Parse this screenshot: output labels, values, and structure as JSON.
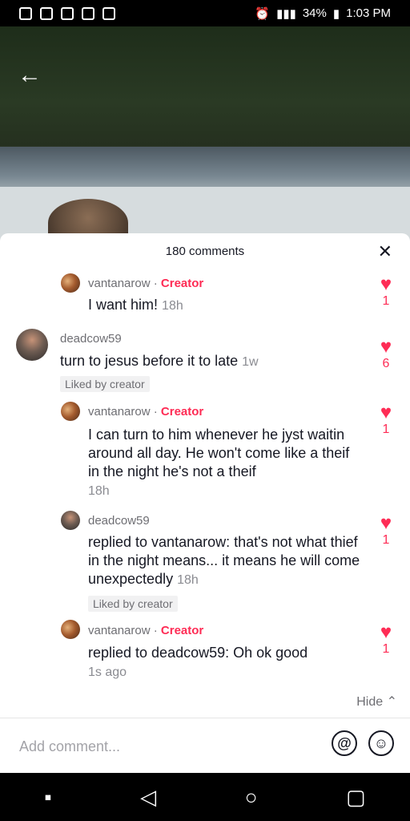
{
  "status_bar": {
    "battery": "34%",
    "time": "1:03 PM"
  },
  "sheet": {
    "title": "180 comments",
    "hide_label": "Hide",
    "add_comment_placeholder": "Add comment..."
  },
  "comments": [
    {
      "username": "vantanarow",
      "badge": "Creator",
      "separator": "·",
      "text": "I want him!",
      "time": "18h",
      "likes": "1"
    },
    {
      "username": "deadcow59",
      "text": "turn to jesus before it to late",
      "time": "1w",
      "liked_by": "Liked by creator",
      "likes": "6"
    },
    {
      "username": "vantanarow",
      "badge": "Creator",
      "separator": "·",
      "text": "I can turn to him whenever he jyst waitin around all day. He won't come like a theif in the night he's not a theif",
      "time": "18h",
      "likes": "1"
    },
    {
      "username": "deadcow59",
      "text": "replied to vantanarow: that's not what thief in the night means... it means he will come unexpectedly",
      "time": "18h",
      "liked_by": "Liked by creator",
      "likes": "1"
    },
    {
      "username": "vantanarow",
      "badge": "Creator",
      "separator": "·",
      "text": "replied to deadcow59: Oh ok good",
      "time": "1s ago",
      "likes": "1"
    }
  ],
  "colors": {
    "accent": "#fe2c55",
    "text": "#161823",
    "muted": "#6e6e73"
  }
}
